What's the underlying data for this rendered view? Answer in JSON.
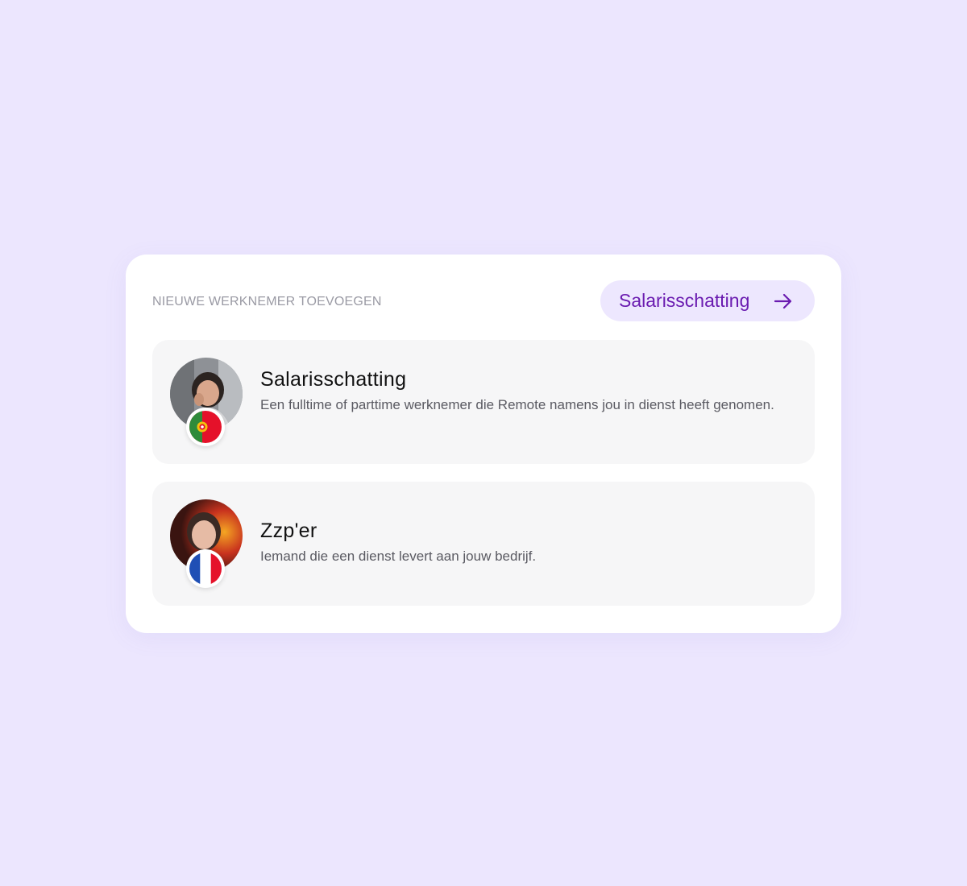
{
  "card": {
    "header_label": "NIEUWE WERKNEMER TOEVOEGEN",
    "cta": {
      "label": "Salarisschatting",
      "icon": "arrow-right-icon",
      "color": "#6A1BB0",
      "background": "#EDE7FE"
    }
  },
  "options": [
    {
      "title": "Salarisschatting",
      "description": "Een fulltime of parttime werknemer die Remote namens jou in dienst heeft genomen.",
      "avatar": "person-avatar",
      "flag": "portugal-flag-icon"
    },
    {
      "title": "Zzp'er",
      "description": "Iemand die een dienst levert aan jouw bedrijf.",
      "avatar": "person-avatar",
      "flag": "france-flag-icon"
    }
  ],
  "colors": {
    "page_background": "#ECE6FE",
    "card_background": "#FFFFFF",
    "option_background": "#F6F6F7"
  }
}
